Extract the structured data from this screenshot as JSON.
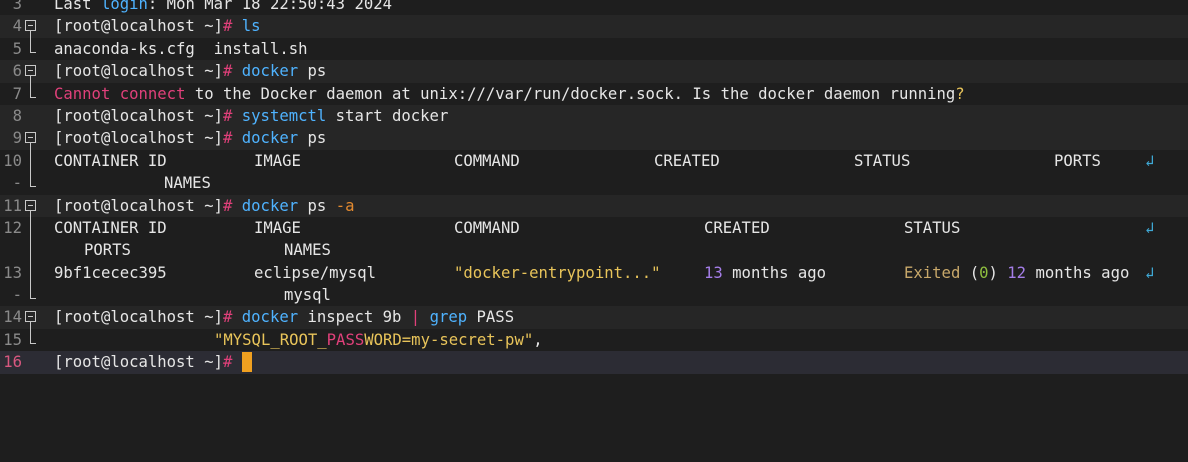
{
  "lines": {
    "l3": {
      "num": "3",
      "a": "Last ",
      "b": "login",
      "c": ": Mon Mar 18 22:50:43 2024"
    },
    "l4": {
      "num": "4",
      "prompt": "[root@localhost ~]",
      "hash": "#",
      "cmd": "ls"
    },
    "l5": {
      "num": "5",
      "text": "anaconda-ks.cfg  install.sh"
    },
    "l6": {
      "num": "6",
      "prompt": "[root@localhost ~]",
      "hash": "#",
      "cmd": "docker",
      "arg": "ps"
    },
    "l7": {
      "num": "7",
      "w1": "Cannot",
      "w2": "connect",
      "w3": " to the Docker daemon at unix:///var/run/docker.sock. Is the docker daemon running",
      "q": "?"
    },
    "l8": {
      "num": "8",
      "prompt": "[root@localhost ~]",
      "hash": "#",
      "cmd": "systemctl",
      "arg": "start docker"
    },
    "l9": {
      "num": "9",
      "prompt": "[root@localhost ~]",
      "hash": "#",
      "cmd": "docker",
      "arg": "ps"
    },
    "l10": {
      "num": "10",
      "cols": [
        "CONTAINER ID",
        "IMAGE",
        "COMMAND",
        "CREATED",
        "STATUS",
        "PORTS"
      ],
      "wrap": "NAMES"
    },
    "l11": {
      "num": "11",
      "prompt": "[root@localhost ~]",
      "hash": "#",
      "cmd": "docker",
      "arg": "ps",
      "flag": "-a"
    },
    "l12": {
      "num": "12",
      "cols": [
        "CONTAINER ID",
        "IMAGE",
        "COMMAND",
        "CREATED",
        "STATUS"
      ],
      "wrap1": "PORTS",
      "wrap2": "NAMES"
    },
    "l13": {
      "num": "13",
      "id": "9bf1cecec395",
      "image": "eclipse/mysql",
      "command": "\"docker-entrypoint...\"",
      "created_n": "13",
      "created_t": " months ago",
      "status_a": "Exited",
      "status_p1": " (",
      "status_code": "0",
      "status_p2": ")",
      "status_n": " 12",
      "status_t": " months ago",
      "wrap": "mysql"
    },
    "l14": {
      "num": "14",
      "prompt": "[root@localhost ~]",
      "hash": "#",
      "cmd": "docker",
      "arg": "inspect 9b",
      "pipe": "|",
      "cmd2": "grep",
      "arg2": "PASS"
    },
    "l15": {
      "num": "15",
      "q1": "\"MYSQL_ROOT_",
      "pass": "PASS",
      "rest": "WORD=my-secret-pw\"",
      "comma": ","
    },
    "l16": {
      "num": "16",
      "prompt": "[root@localhost ~]",
      "hash": "#"
    }
  },
  "wrap_marker": "-",
  "wrap_glyph": "↲",
  "colors": {
    "background": "#1e1e1e",
    "prompt_hash": "#e0407a",
    "command": "#4fb3ff",
    "string": "#e8c45a",
    "cursor": "#f0a020"
  }
}
